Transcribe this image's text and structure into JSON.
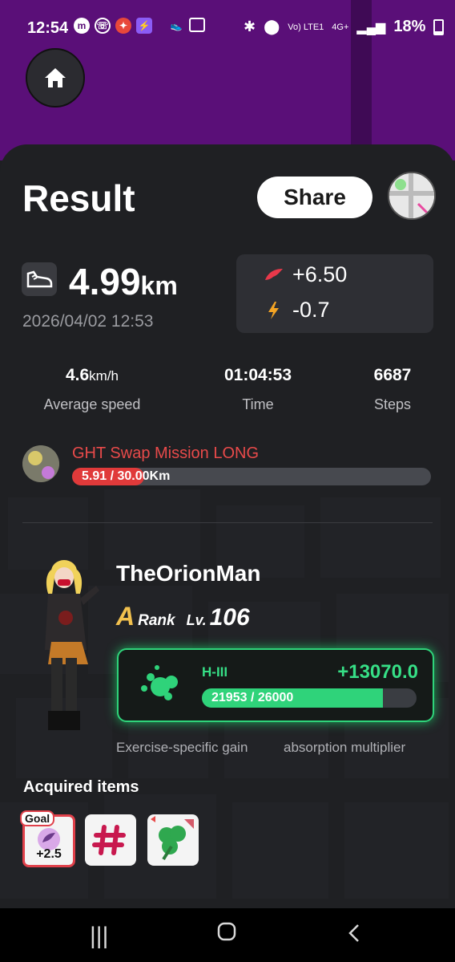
{
  "status_bar": {
    "time": "12:54",
    "network": "Vo) LTE1",
    "network_type": "4G+",
    "battery": "18%"
  },
  "header": {
    "title": "Result",
    "share_label": "Share"
  },
  "run": {
    "distance_value": "4.99",
    "distance_unit": "km",
    "datetime": "2026/04/02 12:53"
  },
  "rewards": {
    "gain": "+6.50",
    "energy": "-0.7"
  },
  "stats": {
    "speed_value": "4.6",
    "speed_unit": "km/h",
    "speed_label": "Average speed",
    "time_value": "01:04:53",
    "time_label": "Time",
    "steps_value": "6687",
    "steps_label": "Steps"
  },
  "mission": {
    "title": "GHT Swap Mission LONG",
    "progress_text": "5.91 / 30.00Km",
    "progress_fraction": 0.197
  },
  "player": {
    "name": "TheOrionMan",
    "rank_letter": "A",
    "rank_word": "Rank",
    "lv_word": "Lv.",
    "level": "106"
  },
  "gain": {
    "level_label": "H-III",
    "amount": "+13070.0",
    "progress_text": "21953 / 26000",
    "progress_fraction": 0.844
  },
  "captions": {
    "left": "Exercise-specific gain",
    "right": "absorption multiplier"
  },
  "items": {
    "title": "Acquired items",
    "goal_badge": "Goal",
    "goal_value": "+2.5"
  },
  "colors": {
    "accent_green": "#2fd37a",
    "mission_red": "#e03a3a",
    "map_purple": "#5a0f78"
  }
}
